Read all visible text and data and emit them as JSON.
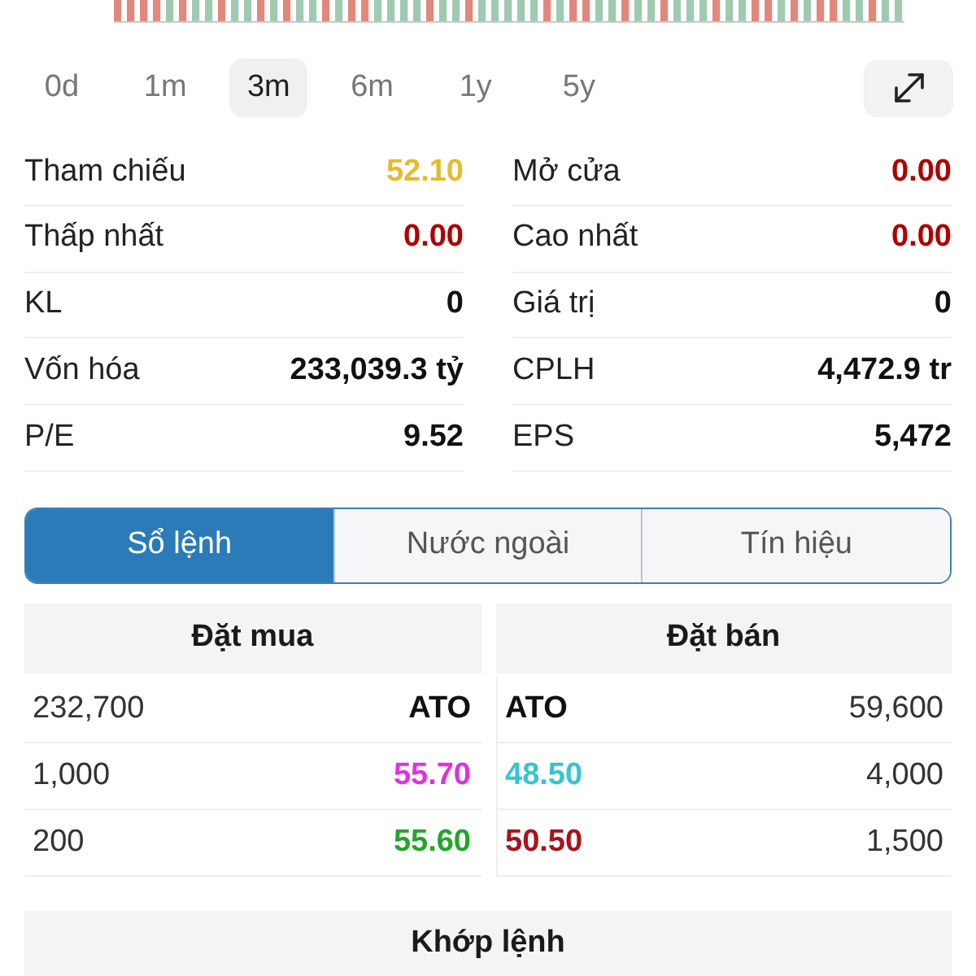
{
  "period_tabs": [
    {
      "label": "0d",
      "selected": false
    },
    {
      "label": "1m",
      "selected": false
    },
    {
      "label": "3m",
      "selected": true
    },
    {
      "label": "6m",
      "selected": false
    },
    {
      "label": "1y",
      "selected": false
    },
    {
      "label": "5y",
      "selected": false
    }
  ],
  "stats_rows": [
    [
      {
        "label": "Tham chiếu",
        "value": "52.10",
        "color": "#e3bc2c"
      },
      {
        "label": "Mở cửa",
        "value": "0.00",
        "color": "#b00000"
      }
    ],
    [
      {
        "label": "Thấp nhất",
        "value": "0.00",
        "color": "#b00000"
      },
      {
        "label": "Cao nhất",
        "value": "0.00",
        "color": "#b00000"
      }
    ],
    [
      {
        "label": "KL",
        "value": "0",
        "color": "#111111"
      },
      {
        "label": "Giá trị",
        "value": "0",
        "color": "#111111"
      }
    ],
    [
      {
        "label": "Vốn hóa",
        "value": "233,039.3 tỷ",
        "color": "#111111"
      },
      {
        "label": "CPLH",
        "value": "4,472.9 tr",
        "color": "#111111"
      }
    ],
    [
      {
        "label": "P/E",
        "value": "9.52",
        "color": "#111111"
      },
      {
        "label": "EPS",
        "value": "5,472",
        "color": "#111111"
      }
    ]
  ],
  "section_tabs": [
    {
      "label": "Sổ lệnh",
      "selected": true
    },
    {
      "label": "Nước ngoài",
      "selected": false
    },
    {
      "label": "Tín hiệu",
      "selected": false
    }
  ],
  "order_book": {
    "bid_header": "Đặt mua",
    "ask_header": "Đặt bán",
    "rows": [
      {
        "bid": {
          "volume": "232,700",
          "price": "ATO",
          "color": "#111111"
        },
        "ask": {
          "price": "ATO",
          "color": "#111111",
          "volume": "59,600"
        }
      },
      {
        "bid": {
          "volume": "1,000",
          "price": "55.70",
          "color": "#e030e0"
        },
        "ask": {
          "price": "48.50",
          "color": "#35c6cf",
          "volume": "4,000"
        }
      },
      {
        "bid": {
          "volume": "200",
          "price": "55.60",
          "color": "#24a52a"
        },
        "ask": {
          "price": "50.50",
          "color": "#a8141a",
          "volume": "1,500"
        }
      }
    ]
  },
  "matched_header": "Khớp lệnh"
}
